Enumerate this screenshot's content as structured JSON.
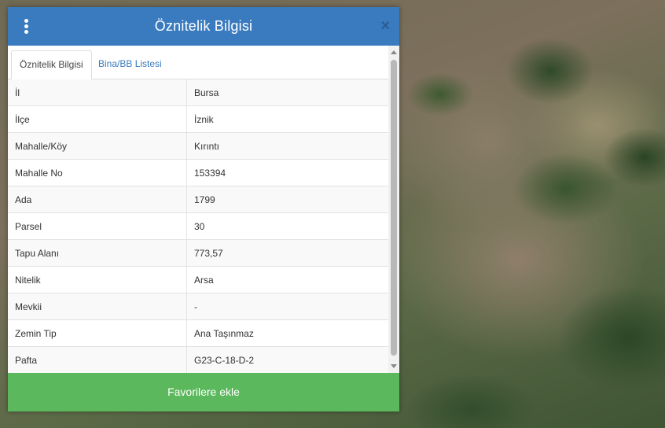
{
  "header": {
    "title": "Öznitelik Bilgisi",
    "close_symbol": "×",
    "color": "#3a7bbf"
  },
  "tabs": [
    {
      "label": "Öznitelik Bilgisi",
      "active": true
    },
    {
      "label": "Bina/BB Listesi",
      "active": false
    }
  ],
  "attributes": [
    {
      "label": "İl",
      "value": "Bursa"
    },
    {
      "label": "İlçe",
      "value": "İznik"
    },
    {
      "label": "Mahalle/Köy",
      "value": "Kırıntı"
    },
    {
      "label": "Mahalle No",
      "value": "153394"
    },
    {
      "label": "Ada",
      "value": "1799"
    },
    {
      "label": "Parsel",
      "value": "30"
    },
    {
      "label": "Tapu Alanı",
      "value": "773,57"
    },
    {
      "label": "Nitelik",
      "value": "Arsa"
    },
    {
      "label": "Mevkii",
      "value": "-"
    },
    {
      "label": "Zemin Tip",
      "value": "Ana Taşınmaz"
    },
    {
      "label": "Pafta",
      "value": "G23-C-18-D-2"
    }
  ],
  "footer": {
    "favorite_label": "Favorilere ekle",
    "color": "#5cb85c"
  },
  "icons": [
    "menu-dots-icon",
    "close-icon",
    "scroll-up-icon",
    "scroll-down-icon"
  ]
}
